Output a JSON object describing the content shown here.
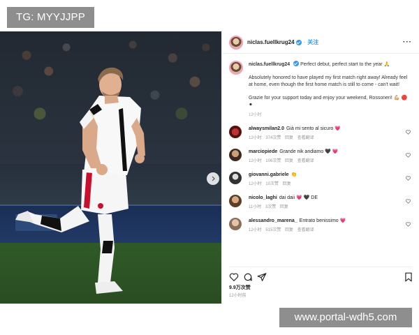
{
  "overlay": {
    "tg_label": "TG: MYYJJPP",
    "watermark": "www.portal-wdh5.com"
  },
  "post": {
    "author": "niclas.fuellkrug24",
    "follow_label": "关注",
    "more_label": "···",
    "caption": {
      "lead": "Perfect debut, perfect start to the year 🙏",
      "paragraph1": "Absolutely honored to have played my first match right away! Already feel at home, even though the first home match is still to come - can't wait!",
      "paragraph2": "Grazie for your support today and enjoy your weekend, Rossoneri! 💪🏼 🔴 ⚫",
      "time": "12小时"
    },
    "comments": [
      {
        "user": "alwaysmilan2.0",
        "text": "Già mi sento al sicuro 💗",
        "time": "12小时",
        "likes": "374次赞",
        "reply": "回复",
        "translate": "查看翻译"
      },
      {
        "user": "marciopiede",
        "text": "Grande nik andiamo 🖤 💗",
        "time": "12小时",
        "likes": "106次赞",
        "reply": "回复",
        "translate": "查看翻译"
      },
      {
        "user": "giovanni.gabriele",
        "text": "👏",
        "time": "12小时",
        "likes": "10次赞",
        "reply": "回复",
        "translate": ""
      },
      {
        "user": "nicolo_laghi",
        "text": "dai daii 💗 🖤 DE",
        "time": "11小时",
        "likes": "3次赞",
        "reply": "回复",
        "translate": ""
      },
      {
        "user": "alessandro_marena_",
        "text": "Entrato benissimo 💗",
        "time": "12小时",
        "likes": "515次赞",
        "reply": "回复",
        "translate": "查看翻译"
      }
    ],
    "likes_count": "9.9万次赞",
    "posted": "12小时前"
  },
  "icons": {
    "like": "heart-icon",
    "comment": "comment-icon",
    "share": "share-icon",
    "save": "bookmark-icon",
    "next": "chevron-right-icon"
  },
  "colors": {
    "accent": "#3897f0",
    "shirt_red": "#c8102e",
    "pitch": "#2f5a27"
  }
}
